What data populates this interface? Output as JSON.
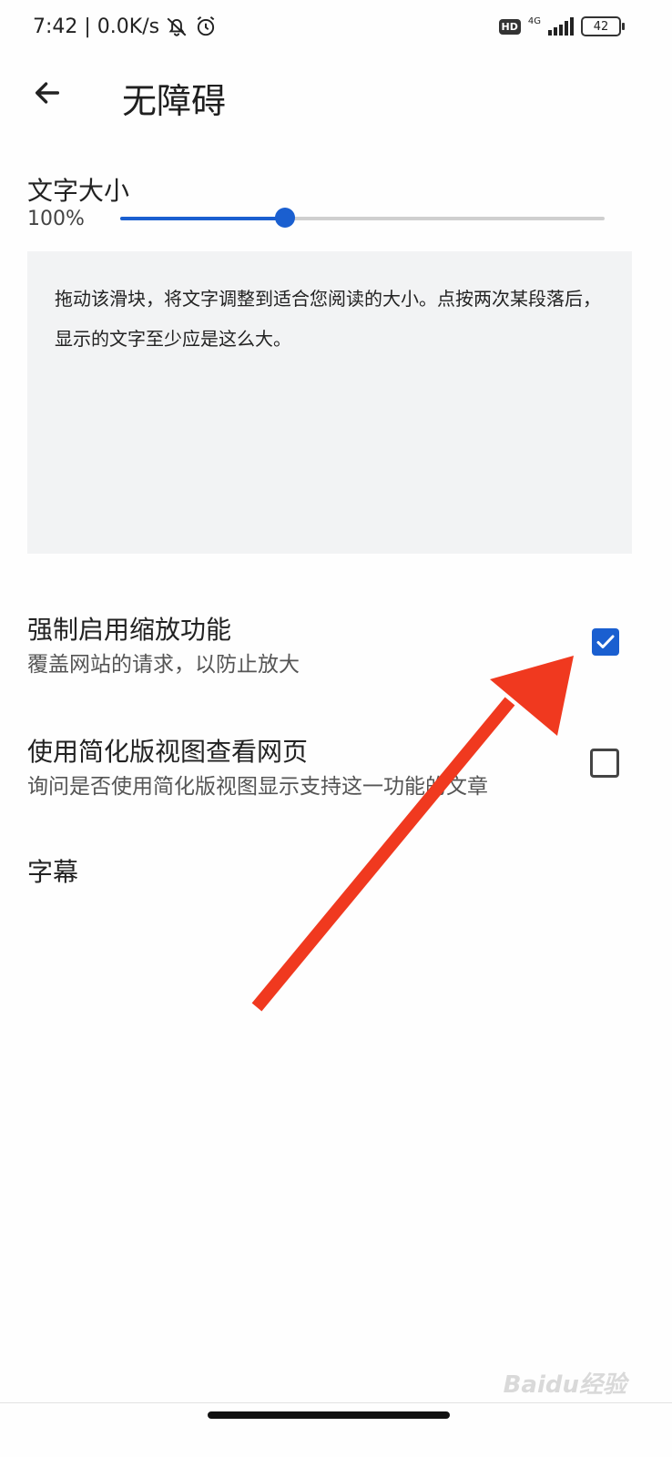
{
  "status_bar": {
    "time_speed": "7:42 | 0.0K/s",
    "hd_badge": "HD",
    "network": "4G",
    "battery": "42"
  },
  "header": {
    "title": "无障碍"
  },
  "text_size": {
    "label": "文字大小",
    "percent": "100%",
    "slider_level": 0.34,
    "preview_text": "拖动该滑块，将文字调整到适合您阅读的大小。点按两次某段落后，显示的文字至少应是这么大。"
  },
  "settings": [
    {
      "title": "强制启用缩放功能",
      "subtitle": "覆盖网站的请求，以防止放大",
      "checked": true
    },
    {
      "title": "使用简化版视图查看网页",
      "subtitle": "询问是否使用简化版视图显示支持这一功能的文章",
      "checked": false
    },
    {
      "title": "字幕"
    }
  ],
  "watermark": "Baidu经验",
  "colors": {
    "accent": "#1a5fd0",
    "annotation_arrow": "#f0391f"
  }
}
